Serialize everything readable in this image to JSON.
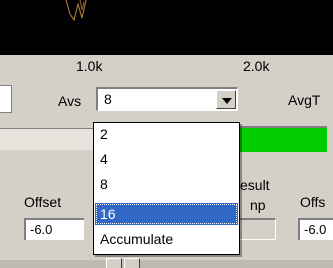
{
  "axis": {
    "tick_1k": "1.0k",
    "tick_2k": "2.0k"
  },
  "averaging": {
    "label": "Avs",
    "selected_value": "8",
    "options": [
      "2",
      "4",
      "8",
      "16",
      "Accumulate"
    ],
    "highlighted_option": "16"
  },
  "avg_type_label": "AvgT",
  "offset": {
    "label": "Offset",
    "value": "-6.0"
  },
  "result": {
    "label_line1": "esult",
    "label_line2": "np"
  },
  "offset_right": {
    "label": "Offs",
    "value": "-6.0"
  },
  "colors": {
    "panel_bg": "#d4d0c8",
    "plot_bg": "#000000",
    "trace": "#b8863b",
    "status_green": "#00cc00",
    "selection": "#3168c6"
  },
  "icons": {
    "combo_arrow": "chevron-down-icon"
  }
}
